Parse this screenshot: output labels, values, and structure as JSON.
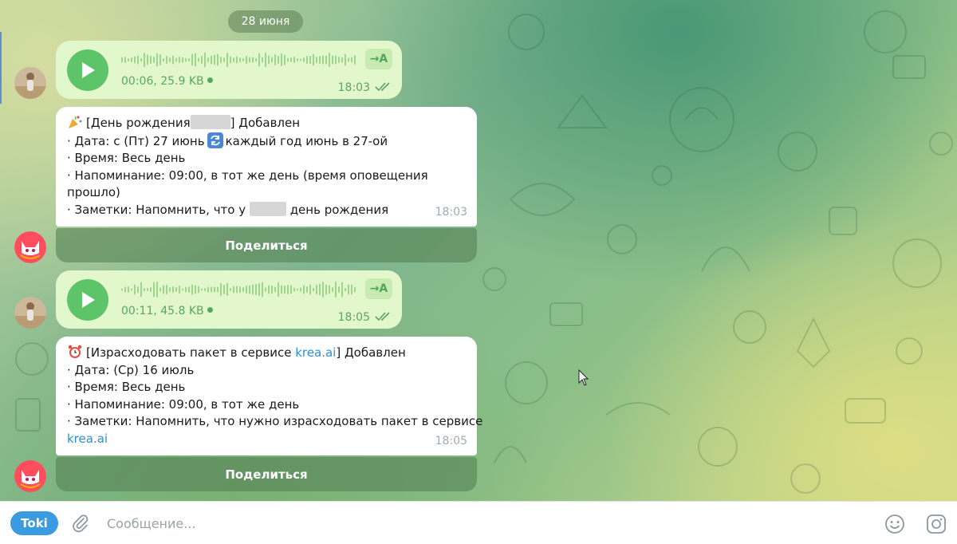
{
  "chat": {
    "date_label": "28 июня"
  },
  "messages": [
    {
      "kind": "voice",
      "duration_size": "00:06, 25.9 KB",
      "time": "18:03",
      "transcribe_label": "→A"
    },
    {
      "kind": "bot",
      "header_prefix": "[День рождения",
      "header_suffix": "] Добавлен",
      "date_line_a": "· Дата: с (Пт) 27 июнь",
      "date_line_b": "каждый год июнь в 27-ой",
      "time_line": "· Время: Весь день",
      "reminder_line": "· Напоминание: 09:00, в тот же день (время оповещения прошло)",
      "notes_prefix": "· Заметки: Напомнить, что у",
      "notes_suffix": "день рождения",
      "time": "18:03",
      "share_label": "Поделиться"
    },
    {
      "kind": "voice",
      "duration_size": "00:11, 45.8 KB",
      "time": "18:05",
      "transcribe_label": "→A"
    },
    {
      "kind": "bot",
      "header_prefix": "[Израсходовать пакет в сервисе",
      "header_link": "krea.ai",
      "header_suffix": "] Добавлен",
      "date_line": "· Дата: (Ср) 16 июль",
      "time_line": "· Время: Весь день",
      "reminder_line": "· Напоминание: 09:00, в тот же день",
      "notes_line": "· Заметки: Напомнить, что нужно израсходовать пакет в сервисе",
      "notes_link": "krea.ai",
      "time": "18:05",
      "share_label": "Поделиться"
    }
  ],
  "composer": {
    "bot_menu_label": "Toki",
    "placeholder": "Сообщение..."
  },
  "icons": {
    "play": "play-icon",
    "attach": "paperclip-icon",
    "emoji": "smiley-icon",
    "sticker": "sticker-icon",
    "read": "double-check-icon",
    "party": "party-popper-emoji",
    "repeat": "repeat-emoji",
    "alarm": "alarm-clock-emoji"
  },
  "colors": {
    "voice_bubble": "#e2f7cb",
    "accent_green": "#5ec46a",
    "link": "#2f8fd0",
    "bot_menu": "#3a9be0"
  }
}
